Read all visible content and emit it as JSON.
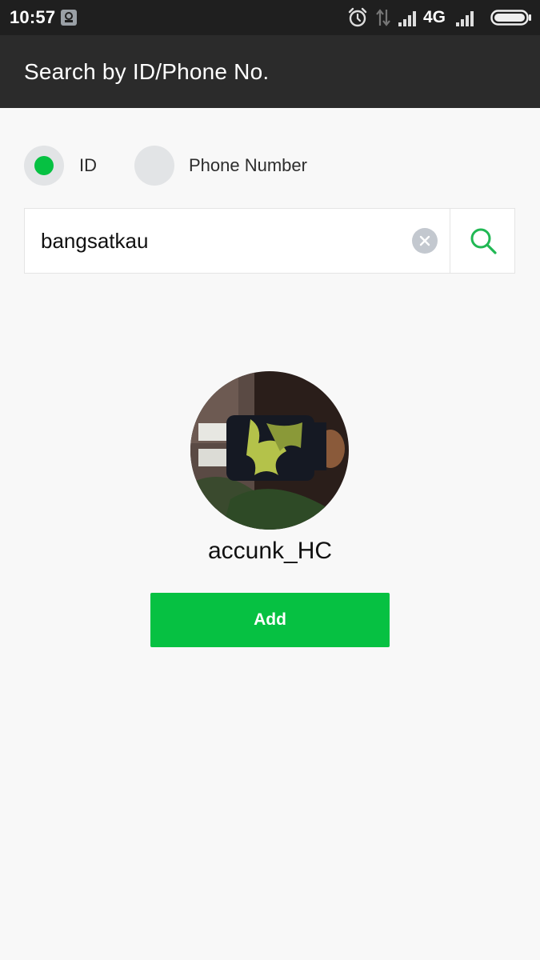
{
  "status_bar": {
    "time": "10:57",
    "network": "4G",
    "icons": [
      "app-notification-icon",
      "alarm-icon",
      "data-transfer-icon",
      "signal-icon",
      "signal-icon",
      "battery-icon"
    ]
  },
  "app_bar": {
    "title": "Search by ID/Phone No."
  },
  "search_type": {
    "options": [
      {
        "label": "ID",
        "selected": true
      },
      {
        "label": "Phone Number",
        "selected": false
      }
    ]
  },
  "search": {
    "value": "bangsatkau",
    "icons": [
      "clear-icon",
      "search-icon"
    ]
  },
  "result": {
    "avatar_icon": "profile-photo",
    "name": "accunk_HC",
    "add_label": "Add"
  },
  "colors": {
    "accent": "#06c142",
    "status_bar": "#1f1f1f",
    "app_bar": "#2b2b2b",
    "background": "#f8f8f8",
    "search_icon": "#21b854",
    "clear_button": "#c3c8cf"
  }
}
